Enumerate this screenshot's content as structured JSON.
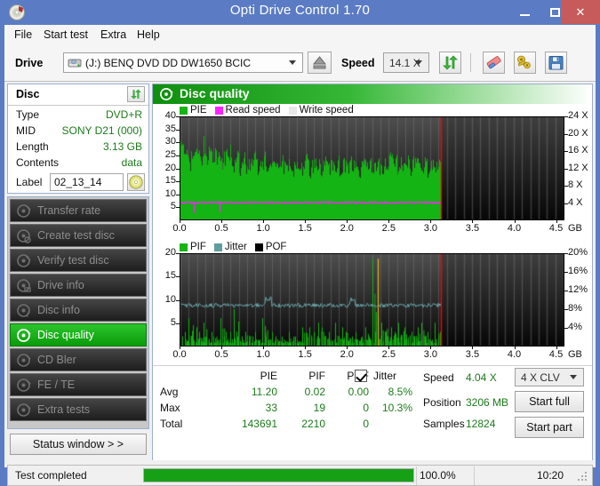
{
  "window": {
    "title": "Opti Drive Control 1.70",
    "app_icon": "disc-icon",
    "minimize_label": "Minimize",
    "maximize_label": "Maximize",
    "close_label": "✕"
  },
  "menu": {
    "items": [
      {
        "label": "File",
        "x": 8
      },
      {
        "label": "Start test",
        "x": 41
      },
      {
        "label": "Extra",
        "x": 105
      },
      {
        "label": "Help",
        "x": 146
      }
    ]
  },
  "toolbar": {
    "drive_label": "Drive",
    "drive_value": "(J:)  BENQ DVD DD DW1650 BCIC",
    "drive_icon": "optical-drive-icon",
    "eject_icon": "eject-icon",
    "speed_label": "Speed",
    "speed_value": "14.1 X",
    "refresh_icon": "refresh-arrows-icon",
    "erase_icon": "eraser-icon",
    "key_icon": "gold-keys-icon",
    "save_icon": "floppy-save-icon"
  },
  "disc_panel": {
    "header": "Disc",
    "refresh_icon": "refresh-arrows-icon",
    "rows": [
      {
        "key": "Type",
        "value": "DVD+R"
      },
      {
        "key": "MID",
        "value": "SONY D21 (000)"
      },
      {
        "key": "Length",
        "value": "3.13 GB"
      },
      {
        "key": "Contents",
        "value": "data"
      }
    ],
    "label_key": "Label",
    "label_value": "02_13_14",
    "label_placeholder": "",
    "disc_button_icon": "cd-disc-icon"
  },
  "nav": {
    "items": [
      {
        "label": "Transfer rate",
        "icon": "disc-transfer-icon",
        "selected": false
      },
      {
        "label": "Create test disc",
        "icon": "disc-create-icon",
        "selected": false
      },
      {
        "label": "Verify test disc",
        "icon": "disc-verify-icon",
        "selected": false
      },
      {
        "label": "Drive info",
        "icon": "disc-drive-icon",
        "selected": false
      },
      {
        "label": "Disc info",
        "icon": "disc-info-icon",
        "selected": false
      },
      {
        "label": "Disc quality",
        "icon": "disc-quality-icon",
        "selected": true
      },
      {
        "label": "CD Bler",
        "icon": "disc-bler-icon",
        "selected": false
      },
      {
        "label": "FE / TE",
        "icon": "disc-fete-icon",
        "selected": false
      },
      {
        "label": "Extra tests",
        "icon": "disc-extra-icon",
        "selected": false
      }
    ],
    "status_window_label": "Status window > >"
  },
  "content": {
    "header_title": "Disc quality",
    "header_icon": "disc-quality-icon"
  },
  "chart_data": [
    {
      "type": "area",
      "name": "pie-chart",
      "title": "",
      "legend": [
        {
          "label": "PIE",
          "color": "#13b413"
        },
        {
          "label": "Read speed",
          "color": "#ff22ff"
        },
        {
          "label": "Write speed",
          "color": "#e8e8e8"
        }
      ],
      "legend_position": "top-left",
      "xlabel": "GB",
      "xlim": [
        0.0,
        4.6
      ],
      "xticks": [
        0.0,
        0.5,
        1.0,
        1.5,
        2.0,
        2.5,
        3.0,
        3.5,
        4.0,
        4.5
      ],
      "xticklabels": [
        "0.0",
        "0.5",
        "1.0",
        "1.5",
        "2.0",
        "2.5",
        "3.0",
        "3.5",
        "4.0",
        "4.5"
      ],
      "ylabel_left": "",
      "ylim_left": [
        0,
        40
      ],
      "yticks_left": [
        5,
        10,
        15,
        20,
        25,
        30,
        35,
        40
      ],
      "yticklabels_left": [
        "5",
        "10",
        "15",
        "20",
        "25",
        "30",
        "35",
        "40"
      ],
      "ylabel_right": "",
      "ylim_right": [
        0,
        24
      ],
      "yticks_right": [
        4,
        8,
        12,
        16,
        20,
        24
      ],
      "yticklabels_right": [
        "4 X",
        "8 X",
        "12 X",
        "16 X",
        "20 X",
        "24 X"
      ],
      "data_end_gb": 3.13,
      "cursor_gb": 3.13,
      "cursor_color": "#ff0000",
      "grid": true,
      "series": [
        {
          "name": "PIE",
          "color": "#13b413",
          "x": [
            0.0,
            0.02,
            0.04,
            0.06,
            0.08,
            0.1,
            0.12,
            0.14,
            0.16,
            0.18,
            0.2,
            0.22,
            0.24,
            0.26,
            0.28,
            0.3,
            0.32,
            0.34,
            0.36,
            0.38,
            0.4,
            0.42,
            0.44,
            0.46,
            0.48,
            0.5,
            0.52,
            0.54,
            0.56,
            0.58,
            0.6,
            0.62,
            0.64,
            0.66,
            0.68,
            0.7,
            0.72,
            0.74,
            0.76,
            0.78,
            0.8,
            0.82,
            0.84,
            0.86,
            0.88,
            0.9,
            0.92,
            0.94,
            0.96,
            0.98,
            1.0,
            1.02,
            1.04,
            1.06,
            1.08,
            1.1,
            1.12,
            1.14,
            1.16,
            1.18,
            1.2,
            1.22,
            1.24,
            1.26,
            1.28,
            1.3,
            1.32,
            1.34,
            1.36,
            1.38,
            1.4,
            1.42,
            1.44,
            1.46,
            1.48,
            1.5,
            1.52,
            1.54,
            1.56,
            1.58,
            1.6,
            1.62,
            1.64,
            1.66,
            1.68,
            1.7,
            1.72,
            1.74,
            1.76,
            1.78,
            1.8,
            1.82,
            1.84,
            1.86,
            1.88,
            1.9,
            1.92,
            1.94,
            1.96,
            1.98,
            2.0,
            2.02,
            2.04,
            2.06,
            2.08,
            2.1,
            2.12,
            2.14,
            2.16,
            2.18,
            2.2,
            2.22,
            2.24,
            2.26,
            2.28,
            2.3,
            2.32,
            2.34,
            2.36,
            2.38,
            2.4,
            2.42,
            2.44,
            2.46,
            2.48,
            2.5,
            2.52,
            2.54,
            2.56,
            2.58,
            2.6,
            2.62,
            2.64,
            2.66,
            2.68,
            2.7,
            2.72,
            2.74,
            2.76,
            2.78,
            2.8,
            2.82,
            2.84,
            2.86,
            2.88,
            2.9,
            2.92,
            2.94,
            2.96,
            2.98,
            3.0,
            3.02,
            3.04,
            3.06,
            3.08,
            3.1,
            3.12
          ],
          "values": [
            33,
            28,
            25,
            24,
            27,
            23,
            22,
            26,
            24,
            23,
            25,
            28,
            24,
            22,
            30,
            26,
            23,
            25,
            29,
            24,
            22,
            26,
            23,
            28,
            24,
            21,
            27,
            23,
            25,
            22,
            26,
            24,
            21,
            23,
            27,
            22,
            16,
            20,
            24,
            22,
            18,
            21,
            23,
            20,
            22,
            25,
            21,
            19,
            23,
            21,
            22,
            24,
            20,
            22,
            25,
            21,
            19,
            23,
            21,
            22,
            20,
            24,
            21,
            19,
            22,
            20,
            23,
            21,
            19,
            22,
            20,
            24,
            21,
            19,
            22,
            20,
            25,
            21,
            19,
            22,
            20,
            23,
            21,
            19,
            22,
            20,
            21,
            23,
            19,
            21,
            20,
            22,
            19,
            21,
            20,
            23,
            19,
            21,
            20,
            22,
            19,
            21,
            20,
            23,
            19,
            21,
            20,
            22,
            19,
            21,
            20,
            23,
            19,
            21,
            20,
            22,
            19,
            21,
            20,
            23,
            19,
            21,
            20,
            22,
            19,
            21,
            27,
            24,
            21,
            19,
            22,
            20,
            23,
            21,
            19,
            22,
            20,
            24,
            21,
            19,
            22,
            20,
            23,
            21,
            19,
            22,
            20,
            24,
            21,
            19,
            22,
            20,
            21,
            19,
            22,
            20,
            24,
            17
          ]
        },
        {
          "name": "Read speed",
          "color": "#ff22ff",
          "constant_value": 6.6,
          "dips": [
            {
              "x": 0.16,
              "value": 2.5
            },
            {
              "x": 0.47,
              "value": 2.8
            }
          ]
        }
      ]
    },
    {
      "type": "area",
      "name": "pif-chart",
      "title": "",
      "legend": [
        {
          "label": "PIF",
          "color": "#13b413"
        },
        {
          "label": "Jitter",
          "color": "#5f9ea0"
        },
        {
          "label": "POF",
          "color": "#000000"
        }
      ],
      "legend_position": "top-left",
      "xlabel": "GB",
      "xlim": [
        0.0,
        4.6
      ],
      "xticks": [
        0.0,
        0.5,
        1.0,
        1.5,
        2.0,
        2.5,
        3.0,
        3.5,
        4.0,
        4.5
      ],
      "xticklabels": [
        "0.0",
        "0.5",
        "1.0",
        "1.5",
        "2.0",
        "2.5",
        "3.0",
        "3.5",
        "4.0",
        "4.5"
      ],
      "ylim_left": [
        0,
        20
      ],
      "yticks_left": [
        5,
        10,
        15,
        20
      ],
      "yticklabels_left": [
        "5",
        "10",
        "15",
        "20"
      ],
      "ylim_right": [
        0,
        20
      ],
      "yticks_right": [
        4,
        8,
        12,
        16,
        20
      ],
      "yticklabels_right": [
        "4%",
        "8%",
        "12%",
        "16%",
        "20%"
      ],
      "data_end_gb": 3.13,
      "cursor_gb": 3.13,
      "cursor_color": "#ff0000",
      "grid": true,
      "series": [
        {
          "name": "PIF",
          "color": "#13b413",
          "x": [
            0.02,
            0.05,
            0.08,
            0.1,
            0.13,
            0.16,
            0.19,
            0.22,
            0.25,
            0.28,
            0.31,
            0.34,
            0.37,
            0.4,
            0.44,
            0.48,
            0.52,
            0.56,
            0.6,
            0.64,
            0.68,
            0.71,
            0.74,
            0.78,
            0.82,
            0.86,
            0.9,
            0.94,
            0.98,
            1.02,
            1.06,
            1.1,
            1.14,
            1.18,
            1.22,
            1.26,
            1.3,
            1.34,
            1.38,
            1.42,
            1.46,
            1.5,
            1.55,
            1.6,
            1.65,
            1.7,
            1.74,
            1.78,
            1.82,
            1.86,
            1.9,
            1.94,
            1.98,
            2.02,
            2.06,
            2.1,
            2.14,
            2.18,
            2.22,
            2.26,
            2.3,
            2.34,
            2.37,
            2.41,
            2.45,
            2.49,
            2.53,
            2.57,
            2.61,
            2.65,
            2.69,
            2.73,
            2.77,
            2.81,
            2.85,
            2.89,
            2.93,
            2.97,
            3.01,
            3.05,
            3.09,
            3.12
          ],
          "values": [
            2,
            3,
            1,
            6,
            2,
            1,
            4,
            3,
            1,
            5,
            2,
            1,
            3,
            2,
            1,
            6,
            2,
            1,
            3,
            8,
            2,
            1,
            2,
            3,
            1,
            2,
            3,
            1,
            6,
            2,
            1,
            3,
            2,
            1,
            2,
            1,
            3,
            1,
            2,
            1,
            4,
            3,
            4,
            3,
            5,
            4,
            2,
            3,
            1,
            5,
            2,
            4,
            3,
            1,
            2,
            3,
            1,
            2,
            4,
            2,
            19,
            3,
            2,
            5,
            3,
            2,
            4,
            3,
            5,
            2,
            4,
            1,
            3,
            2,
            4,
            5,
            2,
            3,
            1,
            5,
            2,
            1
          ]
        },
        {
          "name": "Jitter",
          "color": "#6aa6ad",
          "constant_value": 8.8,
          "avg_percent": 8.5,
          "max_percent": 10.3
        },
        {
          "name": "POF",
          "color": "#000000",
          "values": []
        }
      ]
    }
  ],
  "stats": {
    "columns": [
      "PIE",
      "PIF",
      "POF",
      "Jitter"
    ],
    "jitter_checkbox_checked": true,
    "jitter_label": "Jitter",
    "rows": [
      {
        "label": "Avg",
        "pie": "11.20",
        "pif": "0.02",
        "pof": "0.00",
        "jitter": "8.5%"
      },
      {
        "label": "Max",
        "pie": "33",
        "pif": "19",
        "pof": "0",
        "jitter": "10.3%"
      },
      {
        "label": "Total",
        "pie": "143691",
        "pif": "2210",
        "pof": "0",
        "jitter": ""
      }
    ],
    "side": [
      {
        "label": "Speed",
        "value": "4.04 X"
      },
      {
        "label": "Position",
        "value": "3206 MB"
      },
      {
        "label": "Samples",
        "value": "12824"
      }
    ],
    "write_mode": "4 X CLV",
    "start_full_label": "Start full",
    "start_part_label": "Start part"
  },
  "statusbar": {
    "message": "Test completed",
    "progress_percent": 100,
    "progress_text": "100.0%",
    "elapsed": "10:20",
    "progress_color": "#16a016"
  }
}
